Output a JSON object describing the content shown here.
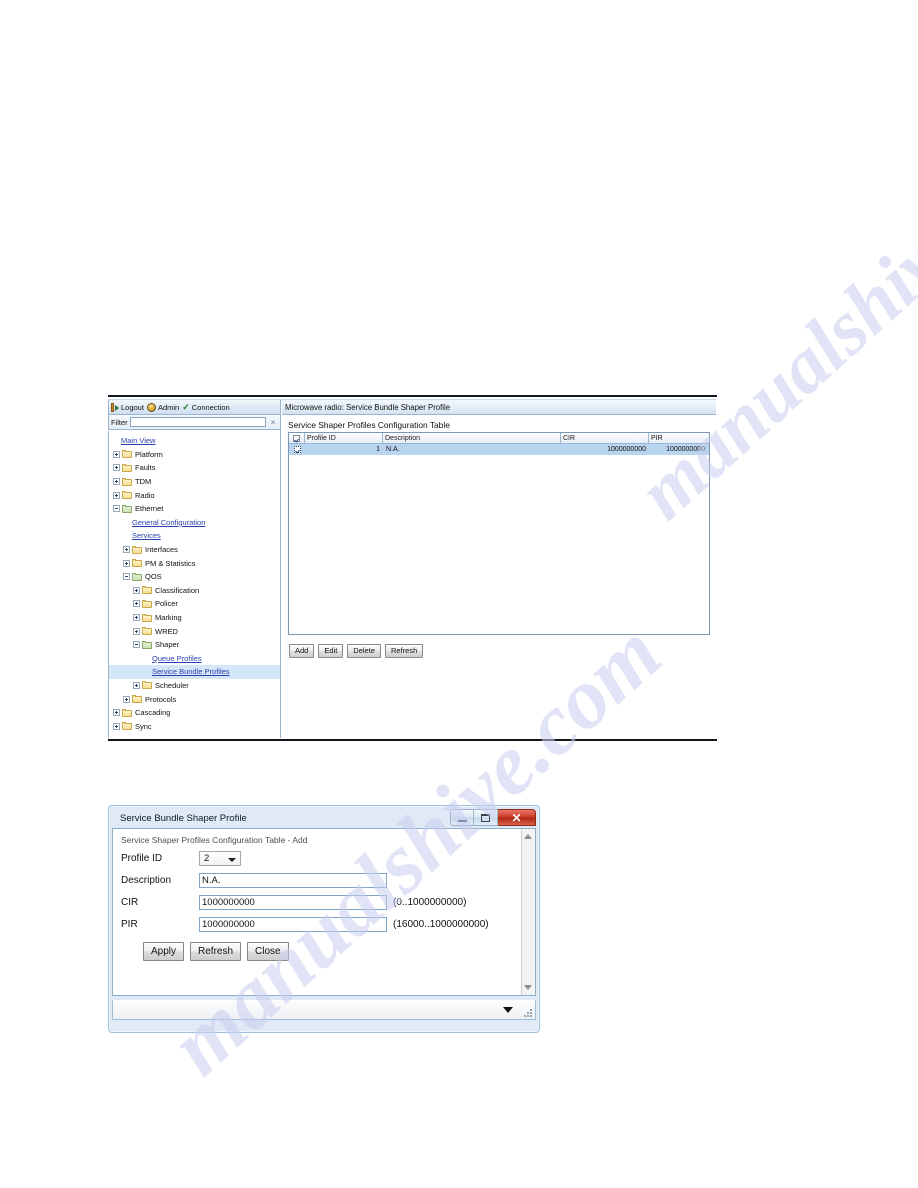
{
  "main_window": {
    "toolbar": {
      "logout": "Logout",
      "admin": "Admin",
      "connection": "Connection"
    },
    "filter": {
      "label": "Filter",
      "value": "",
      "placeholder": "",
      "clear_glyph": "×"
    },
    "tree": {
      "root_link": "Main View",
      "items": [
        {
          "label": "Platform",
          "indent": 0,
          "kind": "folder",
          "state": "collapsed"
        },
        {
          "label": "Faults",
          "indent": 0,
          "kind": "folder",
          "state": "collapsed"
        },
        {
          "label": "TDM",
          "indent": 0,
          "kind": "folder",
          "state": "collapsed"
        },
        {
          "label": "Radio",
          "indent": 0,
          "kind": "folder",
          "state": "collapsed"
        },
        {
          "label": "Ethernet",
          "indent": 0,
          "kind": "folder",
          "state": "expanded"
        },
        {
          "label": "General Configuration",
          "indent": 1,
          "kind": "link",
          "state": "leaf"
        },
        {
          "label": "Services",
          "indent": 1,
          "kind": "link",
          "state": "leaf"
        },
        {
          "label": "Interfaces",
          "indent": 1,
          "kind": "folder",
          "state": "collapsed"
        },
        {
          "label": "PM & Statistics",
          "indent": 1,
          "kind": "folder",
          "state": "collapsed"
        },
        {
          "label": "QOS",
          "indent": 1,
          "kind": "folder",
          "state": "expanded"
        },
        {
          "label": "Classification",
          "indent": 2,
          "kind": "folder",
          "state": "collapsed"
        },
        {
          "label": "Policer",
          "indent": 2,
          "kind": "folder",
          "state": "collapsed"
        },
        {
          "label": "Marking",
          "indent": 2,
          "kind": "folder",
          "state": "collapsed"
        },
        {
          "label": "WRED",
          "indent": 2,
          "kind": "folder",
          "state": "collapsed"
        },
        {
          "label": "Shaper",
          "indent": 2,
          "kind": "folder",
          "state": "expanded"
        },
        {
          "label": "Queue Profiles",
          "indent": 3,
          "kind": "link",
          "state": "leaf"
        },
        {
          "label": "Service Bundle Profiles",
          "indent": 3,
          "kind": "link",
          "state": "leaf",
          "selected": true
        },
        {
          "label": "Scheduler",
          "indent": 2,
          "kind": "folder",
          "state": "collapsed"
        },
        {
          "label": "Protocols",
          "indent": 1,
          "kind": "folder",
          "state": "collapsed"
        },
        {
          "label": "Cascading",
          "indent": 0,
          "kind": "folder",
          "state": "collapsed"
        },
        {
          "label": "Sync",
          "indent": 0,
          "kind": "folder",
          "state": "collapsed"
        }
      ]
    },
    "content": {
      "breadcrumb": "Microwave radio: Service Bundle Shaper Profile",
      "table_caption": "Service Shaper Profiles Configuration Table",
      "columns": [
        "",
        "Profile ID",
        "Description",
        "CIR",
        "PIR"
      ],
      "rows": [
        {
          "checked": true,
          "profile_id": "1",
          "description": "N.A.",
          "cir": "1000000000",
          "pir": "1000000000"
        }
      ],
      "buttons": [
        "Add",
        "Edit",
        "Delete",
        "Refresh"
      ]
    }
  },
  "dialog": {
    "title": "Service Bundle Shaper Profile",
    "form_caption": "Service Shaper Profiles Configuration Table - Add",
    "fields": {
      "profile_id": {
        "label": "Profile ID",
        "value": "2",
        "hint": ""
      },
      "description": {
        "label": "Description",
        "value": "N.A.",
        "hint": ""
      },
      "cir": {
        "label": "CIR",
        "value": "1000000000",
        "hint": "(0..1000000000)"
      },
      "pir": {
        "label": "PIR",
        "value": "1000000000",
        "hint": "(16000..1000000000)"
      }
    },
    "buttons": [
      "Apply",
      "Refresh",
      "Close"
    ],
    "window_controls": {
      "minimize": "minimize-icon",
      "maximize": "maximize-icon",
      "close": "✕"
    }
  },
  "watermark": {
    "line1": "manualshive.com",
    "line2": "manualshive.com"
  }
}
